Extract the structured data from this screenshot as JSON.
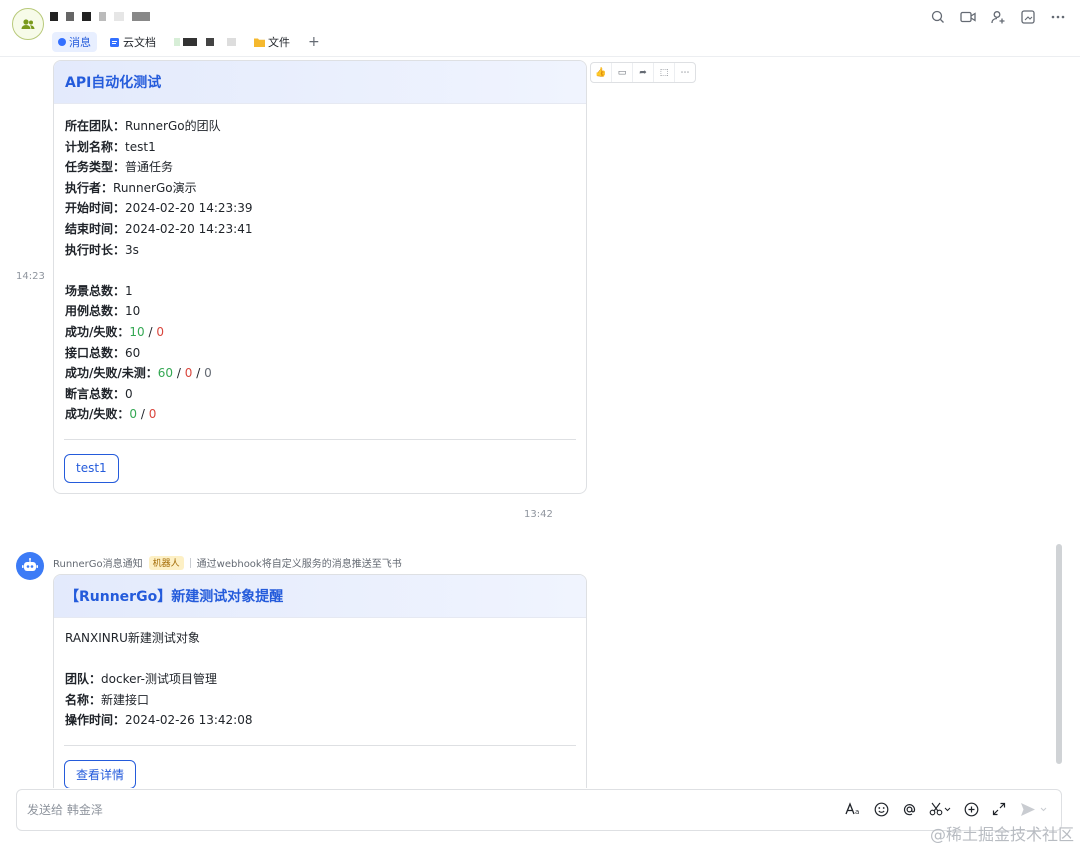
{
  "header": {
    "tabs": [
      {
        "label": "消息"
      },
      {
        "label": "云文档"
      },
      {
        "label": "文件"
      }
    ],
    "add_tab": "+"
  },
  "message1": {
    "title": "API自动化测试",
    "fields": [
      {
        "key": "所在团队",
        "value": "RunnerGo的团队"
      },
      {
        "key": "计划名称",
        "value": "test1"
      },
      {
        "key": "任务类型",
        "value": "普通任务"
      },
      {
        "key": "执行者",
        "value": "RunnerGo演示"
      },
      {
        "key": "开始时间",
        "value": "2024-02-20 14:23:39"
      },
      {
        "key": "结束时间",
        "value": "2024-02-20 14:23:41"
      },
      {
        "key": "执行时长",
        "value": "3s"
      }
    ],
    "stats": {
      "scene_total_key": "场景总数",
      "scene_total": "1",
      "case_total_key": "用例总数",
      "case_total": "10",
      "case_result_key": "成功/失败",
      "case_success": "10",
      "case_fail": "0",
      "api_total_key": "接口总数",
      "api_total": "60",
      "api_result_key": "成功/失败/未测",
      "api_success": "60",
      "api_fail": "0",
      "api_untested": "0",
      "assert_total_key": "断言总数",
      "assert_total": "0",
      "assert_result_key": "成功/失败",
      "assert_success": "0",
      "assert_fail": "0"
    },
    "button": "test1",
    "time": "14:23"
  },
  "time_divider": "13:42",
  "message2": {
    "sender": "RunnerGo消息通知",
    "badge": "机器人",
    "via": "通过webhook将自定义服务的消息推送至飞书",
    "title": "【RunnerGo】新建测试对象提醒",
    "intro": "RANXINRU新建测试对象",
    "fields": [
      {
        "key": "团队",
        "value": "docker-测试项目管理"
      },
      {
        "key": "名称",
        "value": "新建接口"
      },
      {
        "key": "操作时间",
        "value": "2024-02-26 13:42:08"
      }
    ],
    "button": "查看详情"
  },
  "input": {
    "placeholder": "发送给 韩金泽"
  },
  "watermark": "@稀土掘金技术社区",
  "colors": {
    "accent": "#245bdb",
    "success": "#34a853",
    "fail": "#d9463d"
  }
}
